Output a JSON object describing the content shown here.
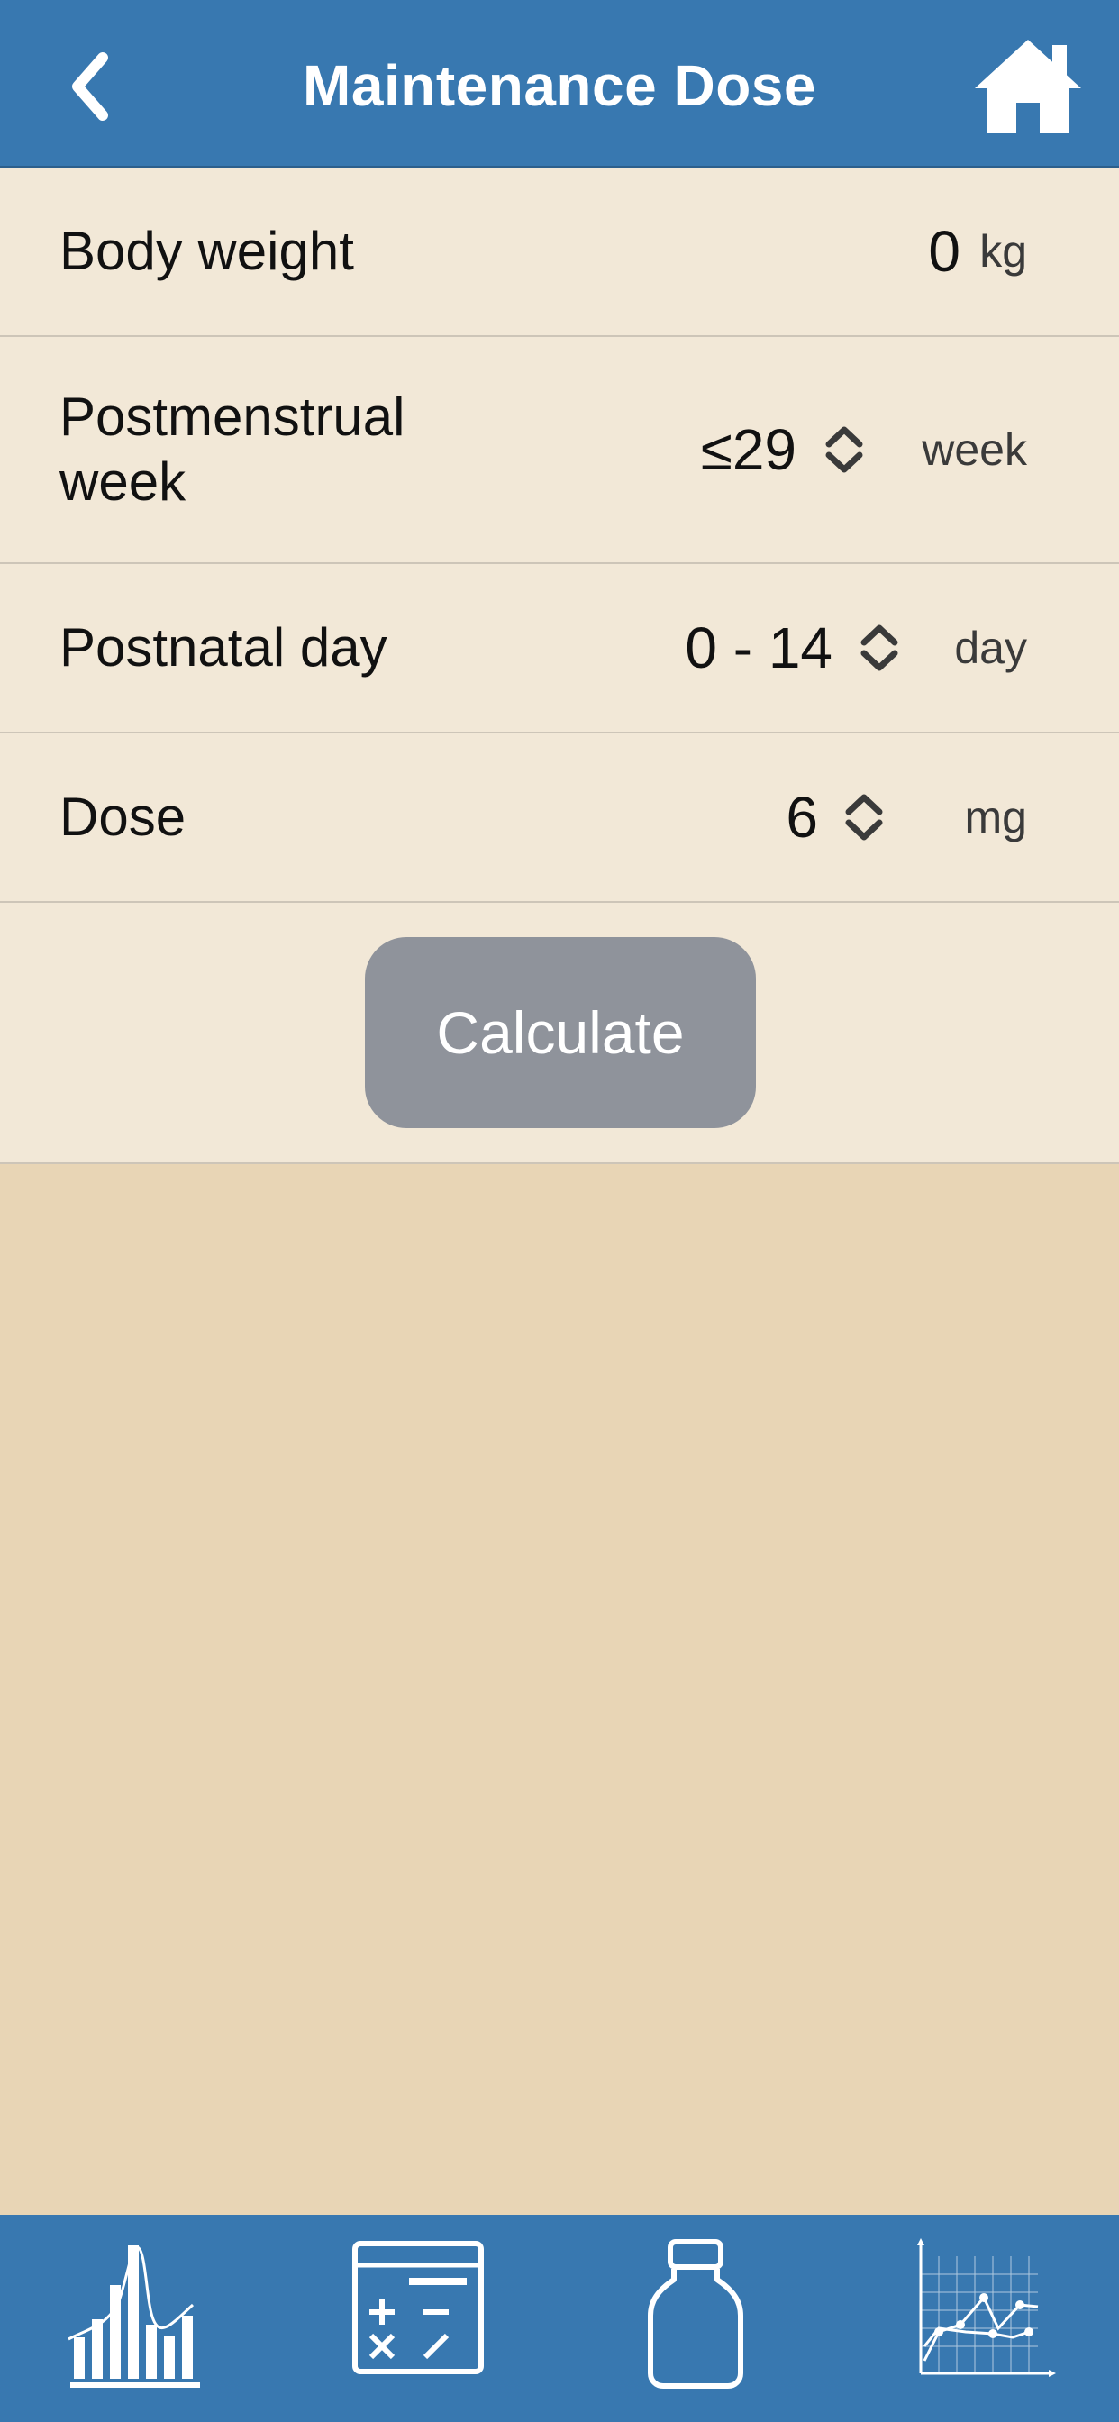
{
  "header": {
    "title": "Maintenance Dose",
    "back_icon": "chevron-left-icon",
    "home_icon": "home-icon"
  },
  "form": {
    "body_weight": {
      "label": "Body weight",
      "value": "0",
      "unit": "kg"
    },
    "postmenstrual_week": {
      "label": "Postmenstrual week",
      "value": "≤29",
      "unit": "week"
    },
    "postnatal_day": {
      "label": "Postnatal day",
      "value": "0 - 14",
      "unit": "day"
    },
    "dose": {
      "label": "Dose",
      "value": "6",
      "unit": "mg"
    }
  },
  "calculate_label": "Calculate",
  "tabbar": {
    "icons": [
      "distribution-chart-icon",
      "calculator-icon",
      "medicine-bottle-icon",
      "line-graph-icon"
    ]
  },
  "colors": {
    "header_bg": "#3878b0",
    "form_bg": "#f2e8d7",
    "page_bg": "#e8d5b5",
    "button_bg": "#8f939b"
  }
}
